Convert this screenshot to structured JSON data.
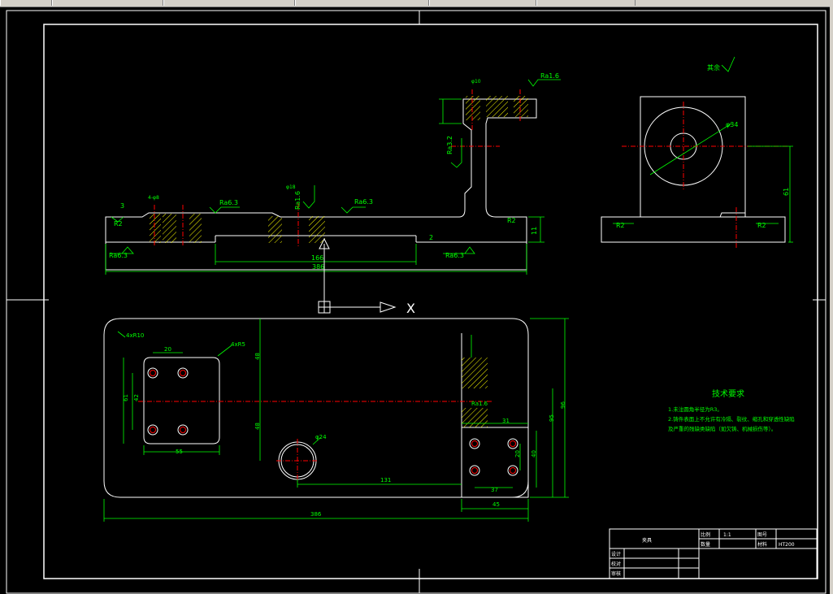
{
  "toolbar": {
    "segments": [
      "",
      "",
      "",
      "",
      ""
    ]
  },
  "axis": {
    "x_label": "X"
  },
  "side_view": {
    "fillet_left": "R2",
    "fillet_right": "R2",
    "dim_height": "61",
    "dim_diameter": "φ34",
    "surface_note": "其余"
  },
  "front_view": {
    "rough_1": "Ra6.3",
    "rough_2": "Ra6.3",
    "rough_3": "Ra6.3",
    "rough_4": "Ra6.3",
    "rough_5": "Ra1.6",
    "rough_6": "Ra3.2",
    "rough_7": "Ra3.2",
    "rough_8": "Ra1.6",
    "dim_overall": "386",
    "dim_inner": "166",
    "dim_small_1": "11",
    "dim_small_2": "2",
    "dim_small_3": "3",
    "fillet_1": "R2",
    "fillet_2": "R2",
    "hole_1": "4-φ8",
    "hole_2": "φ18",
    "hole_3": "φ10"
  },
  "plan_view": {
    "corner_note": "4xR10",
    "pocket_note": "4xR5",
    "dim_20": "20",
    "dim_55": "55",
    "dim_42": "42",
    "dim_61": "61",
    "dim_48a": "48",
    "dim_48b": "48",
    "dim_24": "φ24",
    "dim_131": "131",
    "dim_31": "31",
    "dim_37": "37",
    "dim_45": "45",
    "dim_386": "386",
    "dim_96": "96",
    "dim_95": "95",
    "dim_20b": "20",
    "dim_40": "40",
    "rough": "Ra1.6"
  },
  "tech_req": {
    "title": "技术要求",
    "line1": "1.未注圆角半径为R3。",
    "line2": "2.铸件表面上不允许有冷隔、裂纹、缩孔和穿透性缺陷",
    "line3": "及严重的残缺类缺陷（如欠铸、机械损伤等）。"
  },
  "title_block": {
    "part_name": "夹具",
    "scale_label": "比例",
    "scale_value": "1:1",
    "qty_label": "数量",
    "sheet_label": "图号",
    "material_label": "材料",
    "material_value": "HT200",
    "design_label": "设计",
    "check_label": "校对",
    "approve_label": "审核"
  },
  "colors": {
    "outline": "#ffffff",
    "dimension": "#00ff00",
    "centerline": "#ff0000",
    "hatch": "#ffff00",
    "text": "#00ff00"
  }
}
